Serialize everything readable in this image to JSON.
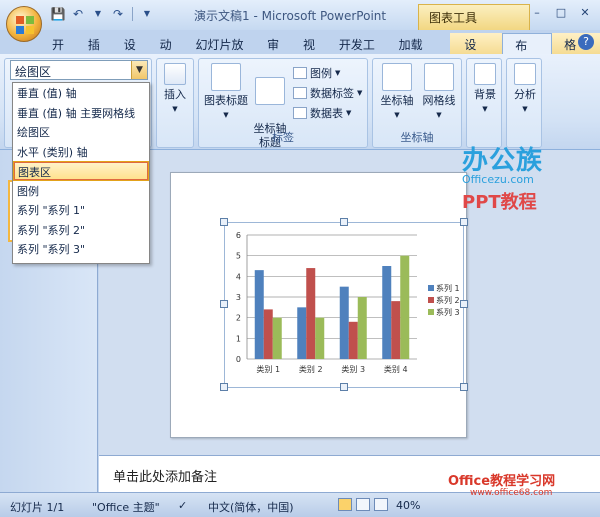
{
  "title": {
    "doc_title": "演示文稿1 - Microsoft PowerPoint",
    "context_tab_title": "图表工具"
  },
  "quick_access": {
    "save_icon": "save-icon",
    "undo_icon": "undo-icon",
    "redo_icon": "redo-icon"
  },
  "tabs": [
    "开始",
    "插入",
    "设计",
    "动画",
    "幻灯片放映",
    "审阅",
    "视图",
    "开发工具",
    "加载项",
    "设计",
    "布局",
    "格式"
  ],
  "ribbon": {
    "selection_box_value": "绘图区",
    "insert_label": "插入",
    "chart_title_label": "图表标题",
    "axis_title_label": "坐标轴\n标题",
    "legend_label": "图例",
    "data_labels_label": "数据标签",
    "data_table_label": "数据表",
    "labels_group": "标签",
    "axes_label": "坐标轴",
    "gridlines_label": "网格线",
    "axes_group": "坐标轴",
    "background_label": "背景",
    "analysis_label": "分析"
  },
  "dropdown": {
    "items": [
      "垂直 (值) 轴",
      "垂直 (值) 轴 主要网格线",
      "绘图区",
      "水平 (类别) 轴",
      "图表区",
      "图例",
      "系列 \"系列 1\"",
      "系列 \"系列 2\"",
      "系列 \"系列 3\""
    ],
    "highlighted": "图表区"
  },
  "brand": {
    "big": "办公族",
    "url": "Officezu.com",
    "ppt": "PPT教程"
  },
  "notes": {
    "placeholder": "单击此处添加备注"
  },
  "watermark": {
    "site": "Office教程学习网",
    "url": "www.office68.com"
  },
  "status": {
    "slide": "幻灯片 1/1",
    "theme": "\"Office 主题\"",
    "language": "中文(简体，中国)",
    "zoom": "40%"
  },
  "colors": {
    "series1": "#4f81bd",
    "series2": "#c0504d",
    "series3": "#9bbb59"
  },
  "chart_data": {
    "type": "bar",
    "categories": [
      "类别 1",
      "类别 2",
      "类别 3",
      "类别 4"
    ],
    "series": [
      {
        "name": "系列 1",
        "values": [
          4.3,
          2.5,
          3.5,
          4.5
        ]
      },
      {
        "name": "系列 2",
        "values": [
          2.4,
          4.4,
          1.8,
          2.8
        ]
      },
      {
        "name": "系列 3",
        "values": [
          2.0,
          2.0,
          3.0,
          5.0
        ]
      }
    ],
    "ylim": [
      0,
      6
    ],
    "yticks": [
      "0",
      "1",
      "2",
      "3",
      "4",
      "5",
      "6"
    ],
    "grid": true,
    "legend_position": "right"
  }
}
